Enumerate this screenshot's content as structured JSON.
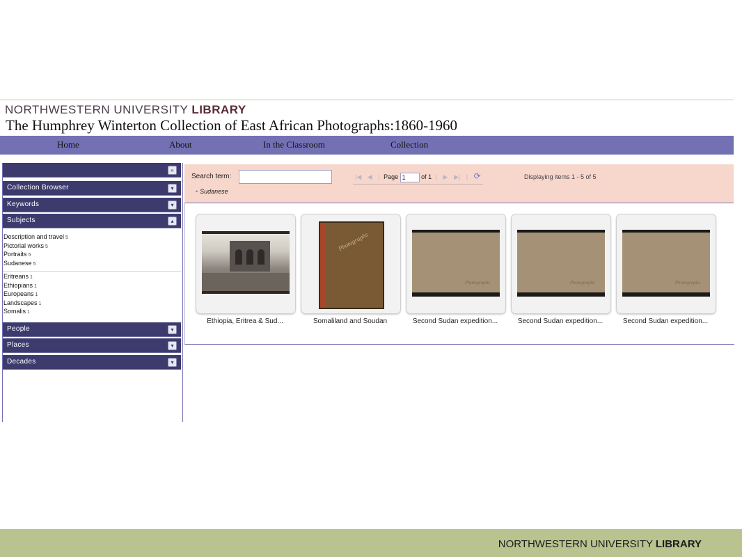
{
  "header": {
    "brand_light": "NORTHWESTERN UNIVERSITY",
    "brand_bold": "LIBRARY",
    "site_title": "The Humphrey Winterton Collection of East African Photographs:1860-1960"
  },
  "nav": {
    "items": [
      {
        "label": "Home"
      },
      {
        "label": "About"
      },
      {
        "label": "In the Classroom"
      },
      {
        "label": "Collection"
      }
    ]
  },
  "sidebar": {
    "collapse_icon": "double-chevron-left-icon",
    "sections": {
      "collection_browser": "Collection Browser",
      "keywords": "Keywords",
      "subjects": "Subjects",
      "people": "People",
      "places": "Places",
      "decades": "Decades"
    },
    "subjects_selected": [
      {
        "label": "Description and travel",
        "count": "5"
      },
      {
        "label": "Pictorial works",
        "count": "5"
      },
      {
        "label": "Portraits",
        "count": "5"
      },
      {
        "label": "Sudanese",
        "count": "5"
      }
    ],
    "subjects_other": [
      {
        "label": "Eritreans",
        "count": "1"
      },
      {
        "label": "Ethiopians",
        "count": "1"
      },
      {
        "label": "Europeans",
        "count": "1"
      },
      {
        "label": "Landscapes",
        "count": "1"
      },
      {
        "label": "Somalis",
        "count": "1"
      }
    ]
  },
  "search": {
    "label": "Search term:",
    "value": "",
    "pager": {
      "page_label": "Page",
      "page_value": "1",
      "of_label": "of 1",
      "display_text": "Displaying items 1 - 5 of 5"
    },
    "active_filter": "Sudanese"
  },
  "results": {
    "items": [
      {
        "title": "Ethiopia, Eritrea & Sud...",
        "thumb": "photo"
      },
      {
        "title": "Somaliland and Soudan",
        "thumb": "book",
        "cover_text": "Photographs"
      },
      {
        "title": "Second Sudan expedition...",
        "thumb": "album",
        "cover_text": "Photographs"
      },
      {
        "title": "Second Sudan expedition...",
        "thumb": "album",
        "cover_text": "Photographs"
      },
      {
        "title": "Second Sudan expedition...",
        "thumb": "album",
        "cover_text": "Photographs"
      }
    ]
  },
  "footer": {
    "brand_light": "NORTHWESTERN UNIVERSITY",
    "brand_bold": "LIBRARY"
  },
  "colors": {
    "nav_bg": "#7470b4",
    "sidebar_header_bg": "#3d3b6e",
    "search_bar_bg": "#f7d6cc",
    "footer_bg": "#b8c38f"
  }
}
